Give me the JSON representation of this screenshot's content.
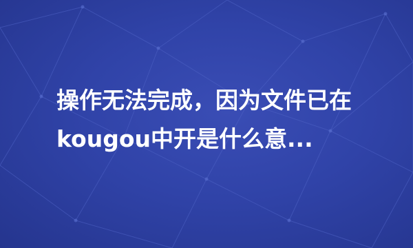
{
  "headline": {
    "line1": "操作无法完成，因为文件已在",
    "line2": "kougou中开是什么意..."
  },
  "background": {
    "color": "#3043a8",
    "pattern": "network-lines"
  }
}
